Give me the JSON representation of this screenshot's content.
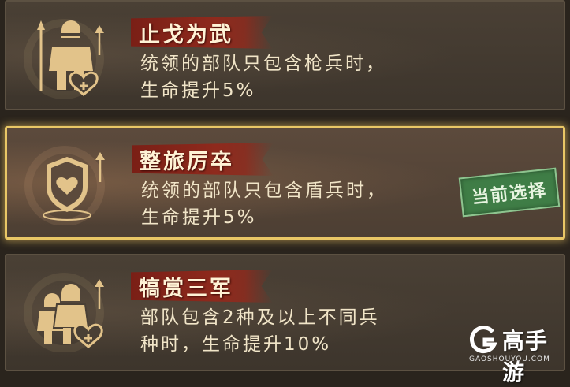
{
  "talents": [
    {
      "title": "止戈为武",
      "desc_line1": "统领的部队只包含枪兵时，",
      "desc_line2": "生命提升5%",
      "icon": "spearman-heart-icon",
      "selected": false
    },
    {
      "title": "整旅厉卒",
      "desc_line1": "统领的部队只包含盾兵时，",
      "desc_line2": "生命提升5%",
      "icon": "shield-heart-icon",
      "selected": true,
      "stamp_label": "当前选择"
    },
    {
      "title": "犒赏三军",
      "desc_line1": "部队包含2种及以上不同兵",
      "desc_line2": "种时，生命提升10%",
      "icon": "troops-heart-icon",
      "selected": false
    }
  ],
  "watermark": {
    "brand": "高手游",
    "domain": "GAOSHOUYOU.COM"
  },
  "colors": {
    "selected_border": "#e9c766",
    "title_banner": "#8e2a1d",
    "stamp_green": "#3f7d46",
    "icon_gold": "#e2c38a"
  }
}
